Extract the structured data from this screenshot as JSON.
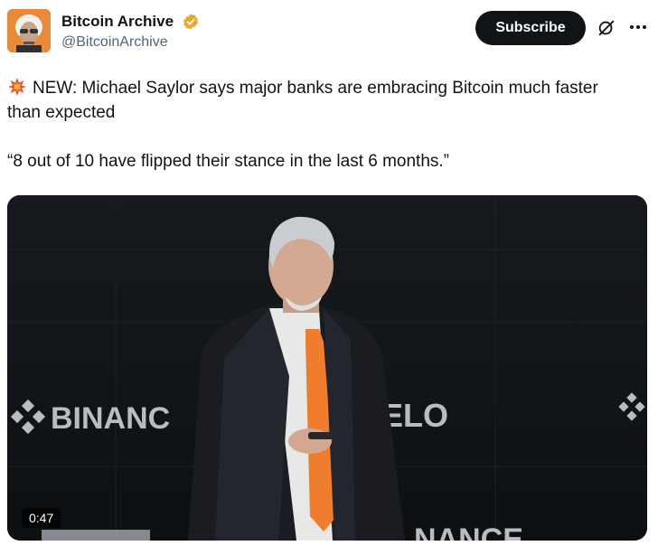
{
  "account": {
    "display_name": "Bitcoin Archive",
    "handle": "@BitcoinArchive",
    "verified": true
  },
  "actions": {
    "subscribe_label": "Subscribe",
    "grok_icon": "grok-icon",
    "more_icon": "more-icon"
  },
  "post": {
    "line1": "NEW: Michael Saylor says major banks are embracing Bitcoin much faster than expected",
    "line2": "“8 out of 10 have flipped their stance in the last 6 months.”",
    "emoji": "collision-icon"
  },
  "media": {
    "duration": "0:47",
    "background_text_left": "BINANC",
    "background_text_right": "ELO",
    "bottom_text": "NANCE",
    "colors": {
      "tie": "#f07c2e",
      "background": "#121519",
      "brand_text": "#b9bcc2"
    }
  },
  "colors": {
    "verified_badge": "#e8a92b",
    "subscribe_bg": "#0f1419",
    "secondary_text": "#536471"
  }
}
